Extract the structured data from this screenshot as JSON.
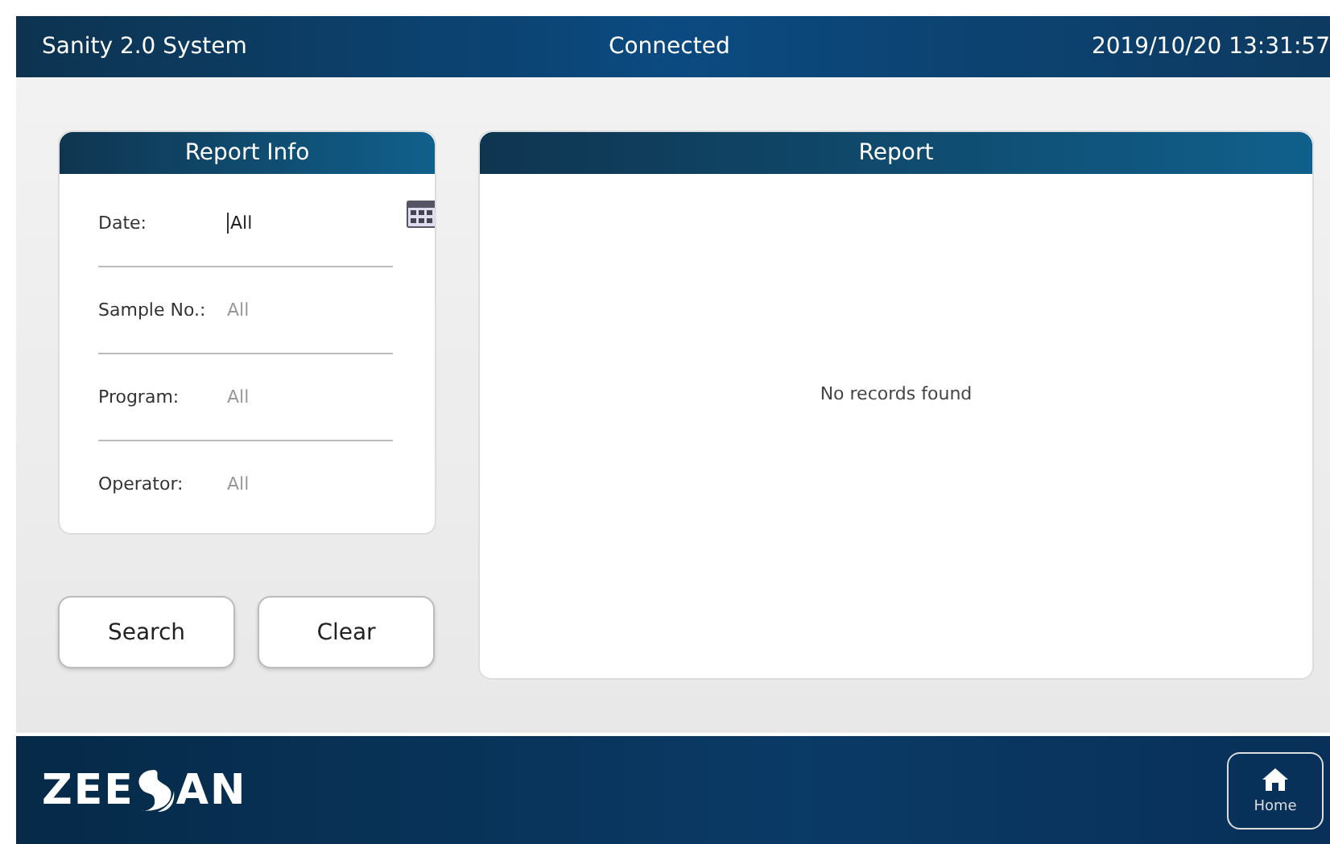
{
  "header": {
    "title": "Sanity 2.0 System",
    "status": "Connected",
    "datetime": "2019/10/20 13:31:57"
  },
  "report_info": {
    "title": "Report Info",
    "fields": [
      {
        "label": "Date:",
        "value": "All",
        "focused": true,
        "calendar": true
      },
      {
        "label": "Sample No.:",
        "placeholder": "All",
        "focused": false,
        "calendar": false
      },
      {
        "label": "Program:",
        "placeholder": "All",
        "focused": false,
        "calendar": false
      },
      {
        "label": "Operator:",
        "placeholder": "All",
        "focused": false,
        "calendar": false
      }
    ]
  },
  "buttons": [
    "Search",
    "Clear"
  ],
  "report": {
    "title": "Report",
    "empty_message": "No records found"
  },
  "footer": {
    "logo_left": "ZEE",
    "logo_right": "AN",
    "home_label": "Home"
  }
}
